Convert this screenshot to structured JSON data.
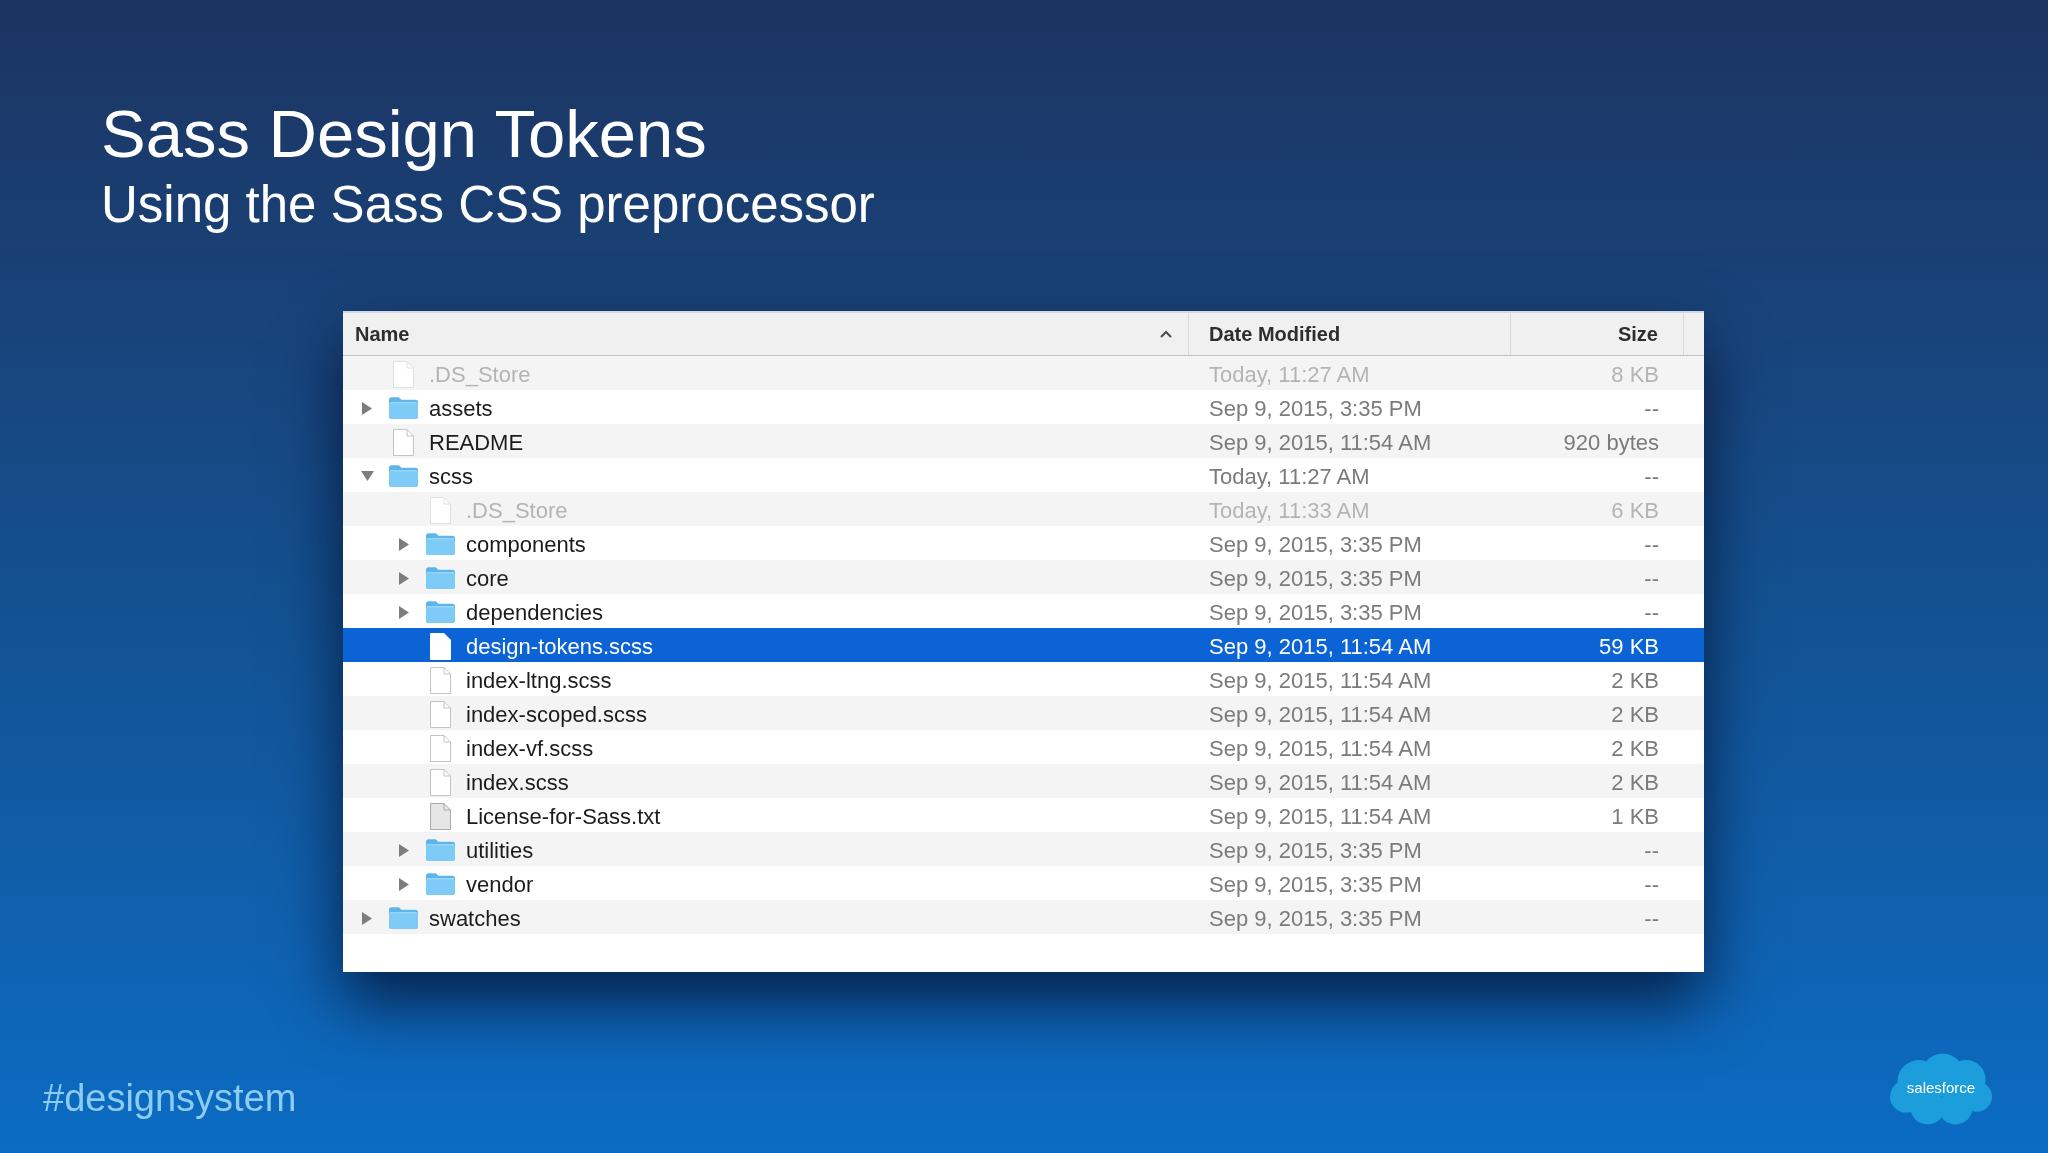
{
  "slide": {
    "title": "Sass Design Tokens",
    "subtitle": "Using the Sass CSS preprocessor"
  },
  "finder": {
    "columns": [
      {
        "label": "Name",
        "sorted": true,
        "descending": false
      },
      {
        "label": "Date Modified",
        "sorted": false
      },
      {
        "label": "Size",
        "sorted": false
      }
    ],
    "items": [
      {
        "kind": "file",
        "name": ".DS_Store",
        "date": "Today, 11:27 AM",
        "size": "8 KB",
        "dimmed": true,
        "selected": false
      },
      {
        "kind": "folder",
        "name": "assets",
        "date": "Sep 9, 2015, 3:35 PM",
        "size": "--",
        "expanded": false,
        "dimmed": false,
        "selected": false
      },
      {
        "kind": "file",
        "name": "README",
        "date": "Sep 9, 2015, 11:54 AM",
        "size": "920 bytes",
        "dimmed": false,
        "selected": false
      },
      {
        "kind": "folder",
        "name": "scss",
        "date": "Today, 11:27 AM",
        "size": "--",
        "expanded": true,
        "dimmed": false,
        "selected": false,
        "children": [
          {
            "kind": "file",
            "name": ".DS_Store",
            "date": "Today, 11:33 AM",
            "size": "6 KB",
            "dimmed": true,
            "selected": false
          },
          {
            "kind": "folder",
            "name": "components",
            "date": "Sep 9, 2015, 3:35 PM",
            "size": "--",
            "expanded": false,
            "dimmed": false,
            "selected": false
          },
          {
            "kind": "folder",
            "name": "core",
            "date": "Sep 9, 2015, 3:35 PM",
            "size": "--",
            "expanded": false,
            "dimmed": false,
            "selected": false
          },
          {
            "kind": "folder",
            "name": "dependencies",
            "date": "Sep 9, 2015, 3:35 PM",
            "size": "--",
            "expanded": false,
            "dimmed": false,
            "selected": false
          },
          {
            "kind": "file",
            "name": "design-tokens.scss",
            "date": "Sep 9, 2015, 11:54 AM",
            "size": "59 KB",
            "dimmed": false,
            "selected": true
          },
          {
            "kind": "file",
            "name": "index-ltng.scss",
            "date": "Sep 9, 2015, 11:54 AM",
            "size": "2 KB",
            "dimmed": false,
            "selected": false
          },
          {
            "kind": "file",
            "name": "index-scoped.scss",
            "date": "Sep 9, 2015, 11:54 AM",
            "size": "2 KB",
            "dimmed": false,
            "selected": false
          },
          {
            "kind": "file",
            "name": "index-vf.scss",
            "date": "Sep 9, 2015, 11:54 AM",
            "size": "2 KB",
            "dimmed": false,
            "selected": false
          },
          {
            "kind": "file",
            "name": "index.scss",
            "date": "Sep 9, 2015, 11:54 AM",
            "size": "2 KB",
            "dimmed": false,
            "selected": false
          },
          {
            "kind": "document",
            "name": "License-for-Sass.txt",
            "date": "Sep 9, 2015, 11:54 AM",
            "size": "1 KB",
            "dimmed": false,
            "selected": false
          },
          {
            "kind": "folder",
            "name": "utilities",
            "date": "Sep 9, 2015, 3:35 PM",
            "size": "--",
            "expanded": false,
            "dimmed": false,
            "selected": false
          },
          {
            "kind": "folder",
            "name": "vendor",
            "date": "Sep 9, 2015, 3:35 PM",
            "size": "--",
            "expanded": false,
            "dimmed": false,
            "selected": false
          }
        ]
      },
      {
        "kind": "folder",
        "name": "swatches",
        "date": "Sep 9, 2015, 3:35 PM",
        "size": "--",
        "expanded": false,
        "dimmed": false,
        "selected": false
      }
    ]
  },
  "hashtag": "#designsystem",
  "logo": {
    "text": "salesforce"
  }
}
